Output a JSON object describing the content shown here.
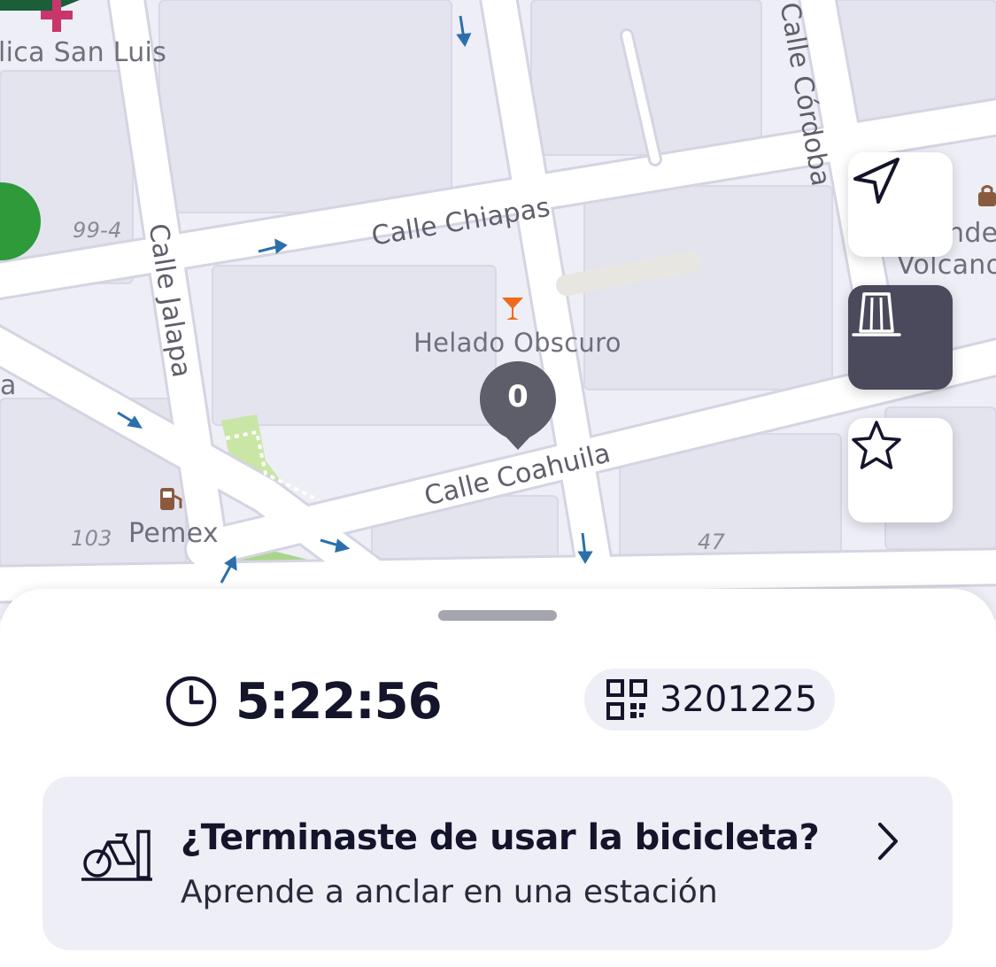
{
  "map": {
    "places": {
      "clinic": "lica San Luis",
      "bar": "Helado Obscuro",
      "gas": "Pemex",
      "shop_line1": "nder",
      "shop_line2": "Volcano",
      "left_edge": "a"
    },
    "streets": {
      "chiapas": "Calle Chiapas",
      "coahuila": "Calle Coahuila",
      "jalapa": "Calle Jalapa",
      "cordoba": "Calle Córdoba"
    },
    "numbers": {
      "n99_4": "99-4",
      "n103": "103",
      "n47": "47"
    },
    "station_pin": {
      "count": "0"
    },
    "colors": {
      "background": "#eeeef7",
      "road": "#ffffff",
      "park": "#c9e6a6",
      "pin": "#5e5e6a",
      "arrow": "#2b6fab"
    }
  },
  "map_controls": [
    {
      "icon": "navigation-arrow-icon",
      "selected": false
    },
    {
      "icon": "station-icon",
      "selected": true
    },
    {
      "icon": "star-icon",
      "selected": false
    }
  ],
  "trip": {
    "timer": "5:22:56",
    "bike_code": "3201225"
  },
  "help_card": {
    "title": "¿Terminaste de usar la bicicleta?",
    "subtitle": "Aprende a anclar en una estación"
  },
  "colors": {
    "text_dark": "#14142b",
    "surface": "#eeeef7",
    "control_selected": "#4a4a5c"
  }
}
